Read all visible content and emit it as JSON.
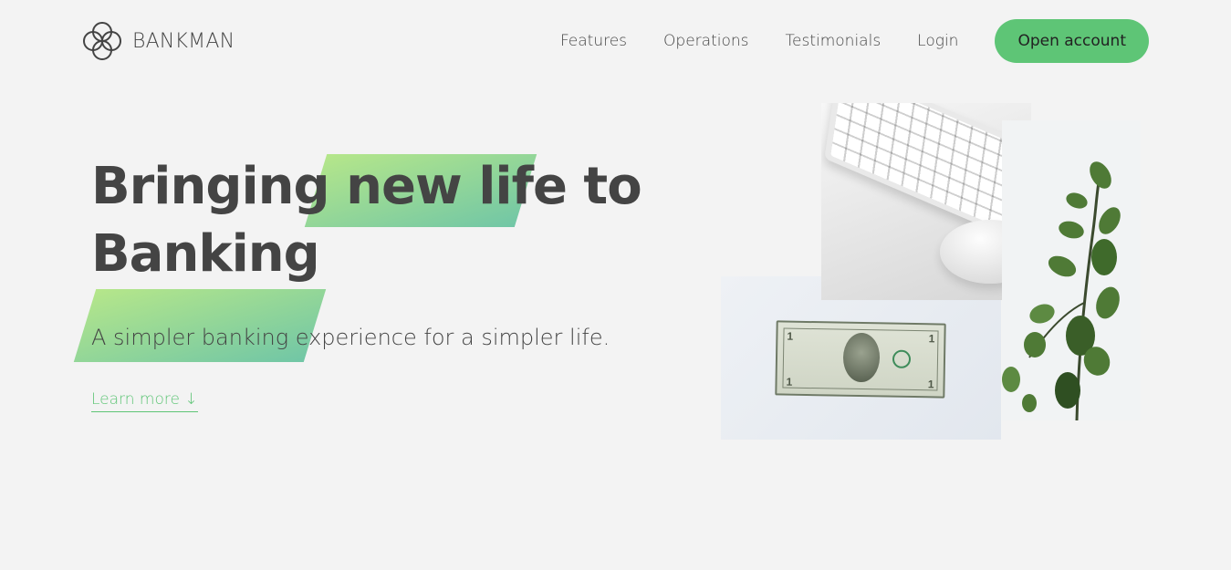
{
  "brand": {
    "name": "BANKMAN",
    "logo_icon": "interlocking-circles-logo-icon"
  },
  "nav": {
    "links": [
      "Features",
      "Operations",
      "Testimonials",
      "Login"
    ],
    "cta_label": "Open account"
  },
  "hero": {
    "title_part1": "Bringing",
    "title_highlight1": "new life",
    "title_part2": "to",
    "title_highlight2": "Banking",
    "subtitle": "A simpler banking experience for a simpler life.",
    "learn_more": "Learn more ↓"
  },
  "images": {
    "keyboard": "keyboard-mouse-photo",
    "bill": "dollar-bill-photo",
    "plant": "eucalyptus-plant-photo"
  },
  "colors": {
    "accent": "#5ec576",
    "text": "#444444",
    "background": "#f3f3f3",
    "highlight_from": "#9be15d",
    "highlight_to": "#39b385"
  }
}
